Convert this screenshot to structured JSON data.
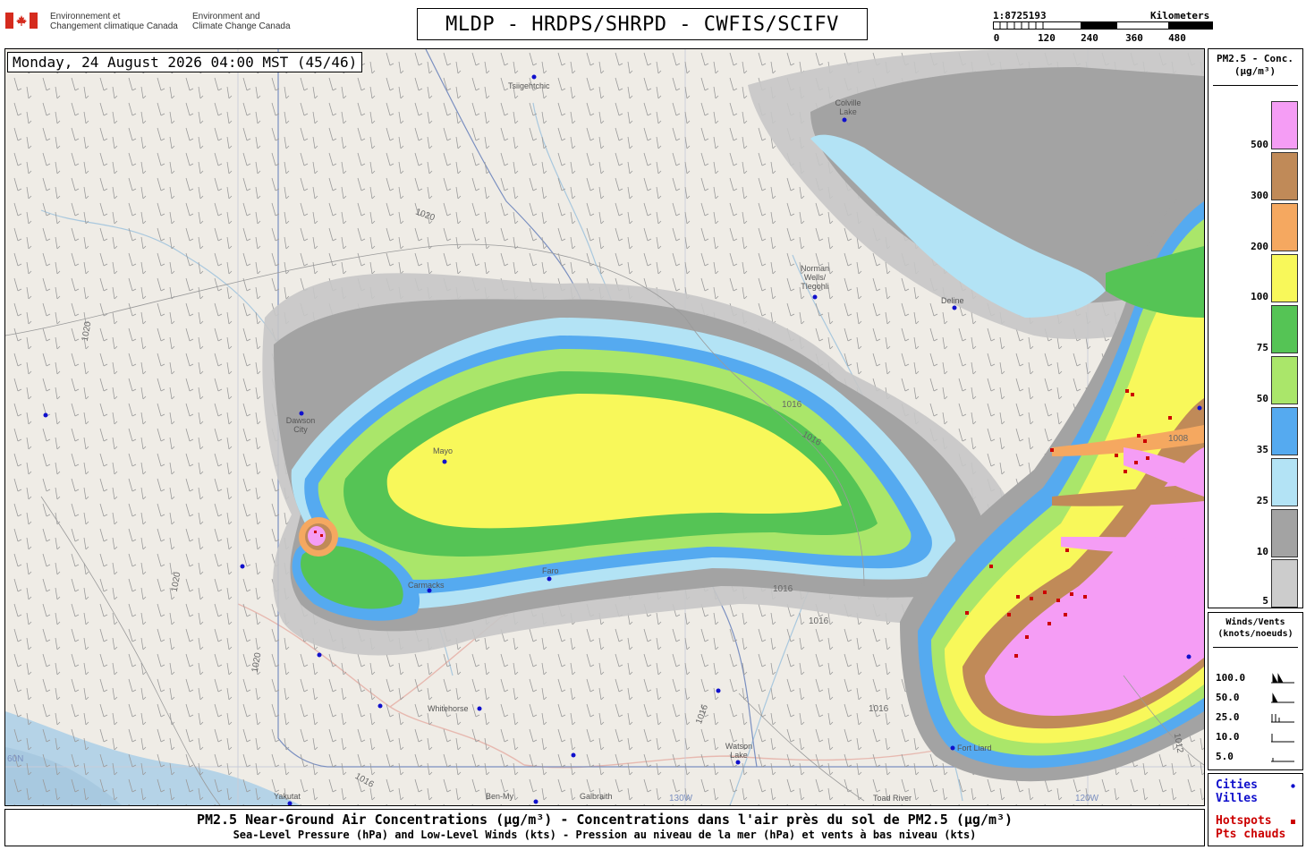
{
  "header": {
    "gov_fr": [
      "Environnement et",
      "Changement climatique Canada"
    ],
    "gov_en": [
      "Environment and",
      "Climate Change Canada"
    ],
    "title": "MLDP - HRDPS/SHRPD - CWFIS/SCIFV",
    "flag_icon": "canada-flag-icon"
  },
  "scale": {
    "ratio": "1:8725193",
    "unit": "Kilometers",
    "ticks": [
      "0",
      "120",
      "240",
      "360",
      "480"
    ]
  },
  "map": {
    "timestamp": "Monday, 24 August 2026 04:00 MST (45/46)",
    "cities": [
      "Tsiigehtchic",
      "Colville Lake",
      "Norman Wells/ Tlegohli",
      "Deline",
      "Dawson City",
      "Mayo",
      "Carmacks",
      "Faro",
      "Whitehorse",
      "Watson Lake",
      "Fort Liard",
      "Yakutat",
      "Ben-My",
      "Galbraith",
      "Toad River"
    ],
    "isobar_labels": [
      "1020",
      "1020",
      "1016",
      "1016",
      "1016",
      "1016",
      "1016",
      "1016",
      "1012",
      "1008",
      "1020",
      "1020",
      "1016"
    ],
    "graticule_labels": [
      "130W",
      "120W",
      "60N"
    ],
    "colors": {
      "land": "#efece6",
      "water": "#b5d3e7",
      "boundary": "#7a8fc0",
      "road": "#e7b9b0",
      "city": "#1010cc",
      "hotspot": "#cc0000"
    }
  },
  "legend": {
    "concentration": {
      "title": "PM2.5 - Conc. (µg/m³)",
      "levels": [
        {
          "label": "500",
          "color": "#f59df5"
        },
        {
          "label": "300",
          "color": "#c08a58"
        },
        {
          "label": "200",
          "color": "#f5a860"
        },
        {
          "label": "100",
          "color": "#f8f85a"
        },
        {
          "label": "75",
          "color": "#55c455"
        },
        {
          "label": "50",
          "color": "#aae66a"
        },
        {
          "label": "35",
          "color": "#55aaf0"
        },
        {
          "label": "25",
          "color": "#b3e3f5"
        },
        {
          "label": "10",
          "color": "#a3a3a3"
        },
        {
          "label": "5",
          "color": "#cccccc"
        }
      ]
    },
    "winds": {
      "title": "Winds/Vents (knots/noeuds)",
      "speeds": [
        "100.0",
        "50.0",
        "25.0",
        "10.0",
        "5.0"
      ]
    },
    "points": {
      "cities": "Cities",
      "villes": "Villes",
      "hotspots": "Hotspots",
      "pts_chauds": "Pts chauds"
    }
  },
  "footer": {
    "line1": "PM2.5 Near-Ground Air Concentrations (µg/m³) - Concentrations dans l'air près du sol de PM2.5 (µg/m³)",
    "line2": "Sea-Level Pressure (hPa) and Low-Level Winds (kts) - Pression au niveau de la mer (hPa) et vents à bas niveau (kts)"
  }
}
